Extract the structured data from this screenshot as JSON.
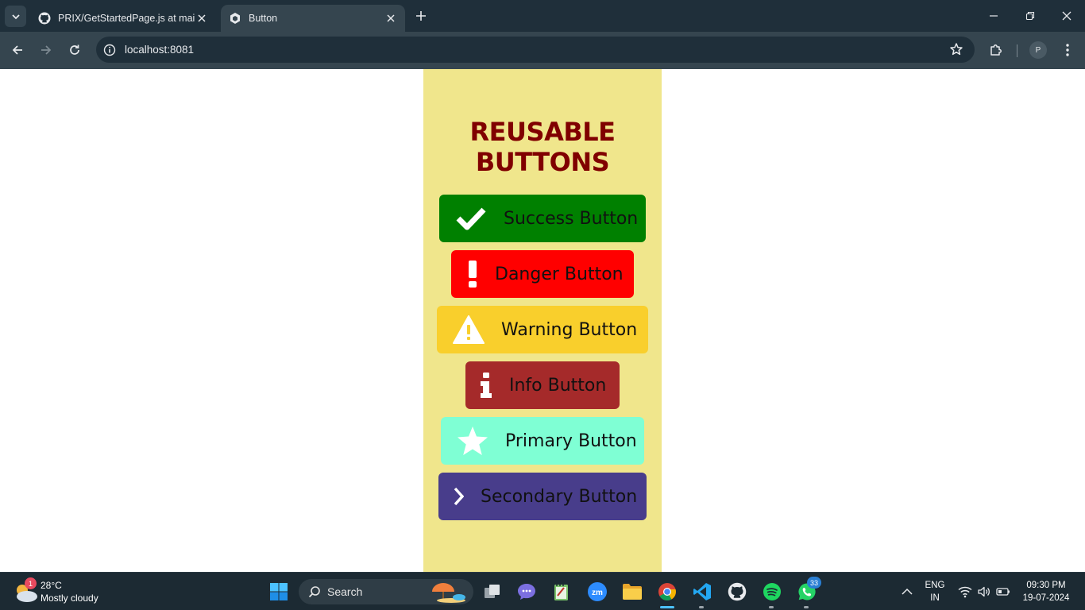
{
  "browser": {
    "tabs": [
      {
        "title": "PRIX/GetStartedPage.js at main",
        "active": false,
        "favicon": "github-icon"
      },
      {
        "title": "Button",
        "active": true,
        "favicon": "expo-icon"
      }
    ],
    "url": "localhost:8081",
    "profile_initial": "P"
  },
  "page": {
    "heading": "REUSABLE BUTTONS",
    "background": "#f0e68c",
    "heading_color": "#800000",
    "buttons": [
      {
        "label": "Success Button",
        "icon": "check-icon",
        "color": "#008000"
      },
      {
        "label": "Danger Button",
        "icon": "exclamation-icon",
        "color": "#ff0000"
      },
      {
        "label": "Warning Button",
        "icon": "warning-triangle-icon",
        "color": "#f9cf2c"
      },
      {
        "label": "Info Button",
        "icon": "info-icon",
        "color": "#a52a2a"
      },
      {
        "label": "Primary Button",
        "icon": "star-icon",
        "color": "#7fffd4"
      },
      {
        "label": "Secondary Button",
        "icon": "chevron-right-icon",
        "color": "#483d8b"
      }
    ]
  },
  "taskbar": {
    "weather": {
      "temp": "28°C",
      "condition": "Mostly cloudy",
      "badge": "1"
    },
    "search_label": "Search",
    "whatsapp_badge": "33",
    "language": {
      "line1": "ENG",
      "line2": "IN"
    },
    "clock": {
      "time": "09:30 PM",
      "date": "19-07-2024"
    }
  }
}
